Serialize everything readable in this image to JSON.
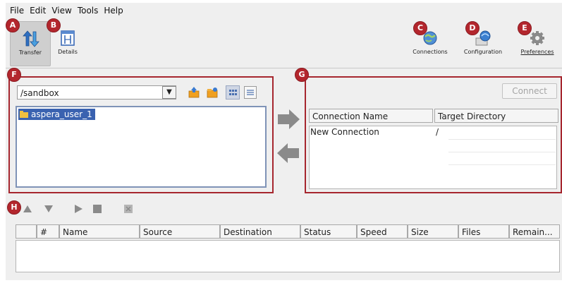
{
  "menu": [
    "File",
    "Edit",
    "View",
    "Tools",
    "Help"
  ],
  "toolbar": {
    "transfer_label": "Transfer",
    "details_label": "Details",
    "connections_label": "Connections",
    "configuration_label": "Configuration",
    "preferences_label": "Preferences"
  },
  "callouts": {
    "transfer": "A",
    "details": "B",
    "connections": "C",
    "configuration": "D",
    "preferences": "E",
    "local_panel": "F",
    "remote_panel": "G",
    "queue": "H"
  },
  "local": {
    "path": "/sandbox",
    "items": [
      "aspera_user_1"
    ]
  },
  "remote": {
    "connect_label": "Connect",
    "columns": [
      "Connection Name",
      "Target Directory"
    ],
    "rows": [
      {
        "name": "New Connection",
        "target": "/"
      }
    ]
  },
  "queue": {
    "columns": [
      "",
      "#",
      "Name",
      "Source",
      "Destination",
      "Status",
      "Speed",
      "Size",
      "Files",
      "Remain..."
    ]
  },
  "colors": {
    "callout": "#b3262d",
    "selection": "#3a62b0",
    "panel_border": "#a6262e"
  }
}
